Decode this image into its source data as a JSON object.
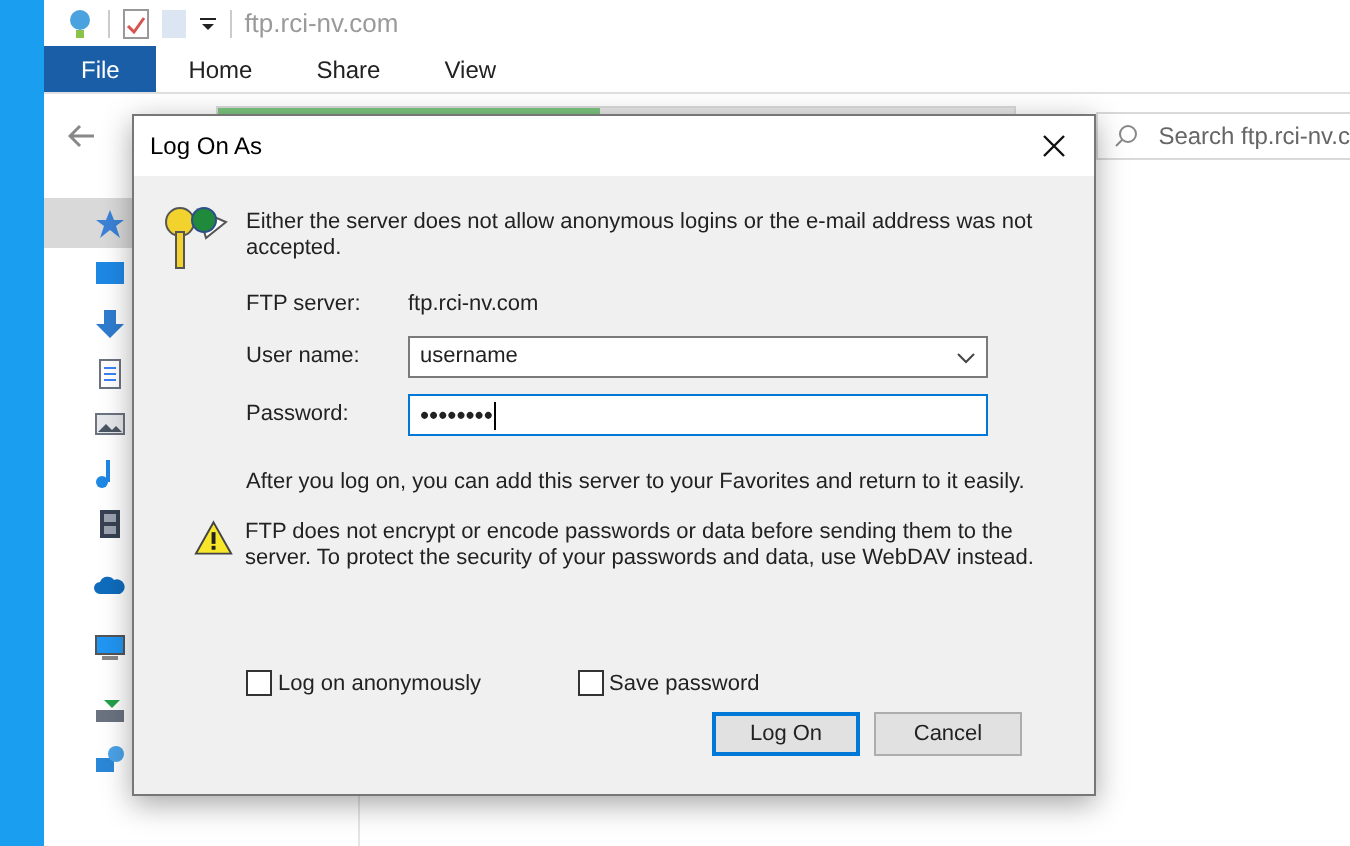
{
  "window": {
    "title": "ftp.rci-nv.com"
  },
  "ribbon_tabs": [
    {
      "label": "File",
      "selected": true
    },
    {
      "label": "Home",
      "selected": false
    },
    {
      "label": "Share",
      "selected": false
    },
    {
      "label": "View",
      "selected": false
    }
  ],
  "address_bar": {
    "level": 0.48
  },
  "search": {
    "placeholder": "Search ftp.rci-nv.c"
  },
  "navigation_pane": {
    "items": [
      {
        "kind": "star",
        "selected": true
      },
      {
        "kind": "desktop",
        "selected": false
      },
      {
        "kind": "download",
        "selected": false
      },
      {
        "kind": "document",
        "selected": false
      },
      {
        "kind": "pictures",
        "selected": false
      },
      {
        "kind": "music",
        "selected": false
      },
      {
        "kind": "video",
        "selected": false
      },
      {
        "kind": "cloud",
        "selected": false
      },
      {
        "kind": "pc",
        "selected": false
      },
      {
        "kind": "drive",
        "selected": false
      },
      {
        "kind": "network",
        "selected": false
      }
    ]
  },
  "dialog": {
    "title": "Log On As",
    "message": "Either the server does not allow anonymous logins or the e-mail address was not accepted.",
    "server_label": "FTP server:",
    "server_value": "ftp.rci-nv.com",
    "user_label": "User name:",
    "user_value": "username",
    "password_label": "Password:",
    "password_value": "••••••••",
    "info": "After you log on, you can add this server to your Favorites and return to it easily.",
    "warning": "FTP does not encrypt or encode passwords or data before sending them to the server.  To protect the security of your passwords and data, use WebDAV instead.",
    "checkboxes": [
      {
        "label": "Log on anonymously",
        "checked": false
      },
      {
        "label": "Save password",
        "checked": false
      }
    ],
    "buttons": [
      {
        "label": "Log On",
        "selected": true
      },
      {
        "label": "Cancel",
        "selected": false
      }
    ]
  }
}
